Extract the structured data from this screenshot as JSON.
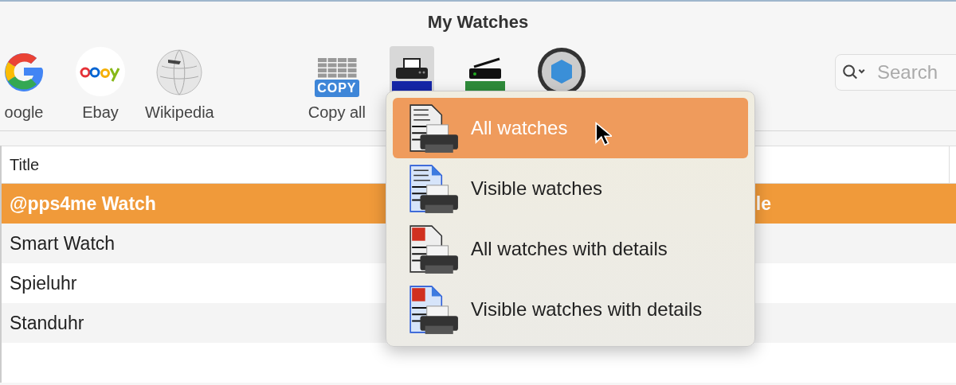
{
  "window": {
    "title": "My Watches"
  },
  "toolbar": {
    "items": [
      {
        "kind": "google",
        "label": "oogle"
      },
      {
        "kind": "ebay",
        "label": "Ebay"
      },
      {
        "kind": "wikipedia",
        "label": "Wikipedia"
      },
      {
        "kind": "copy",
        "label": "Copy all",
        "badge": "COPY"
      },
      {
        "kind": "print"
      },
      {
        "kind": "scan"
      },
      {
        "kind": "aperture"
      }
    ],
    "search": {
      "placeholder": "Search"
    }
  },
  "table": {
    "columns": [
      "Title"
    ],
    "rows": [
      {
        "title": "@pps4me Watch",
        "column_2": "le",
        "selected": true
      },
      {
        "title": "Smart Watch",
        "selected": false
      },
      {
        "title": "Spieluhr",
        "selected": false
      },
      {
        "title": "Standuhr",
        "selected": false
      }
    ]
  },
  "menu": {
    "items": [
      {
        "label": "All watches",
        "kind": "all",
        "selected": true
      },
      {
        "label": "Visible watches",
        "kind": "visible",
        "selected": false
      },
      {
        "label": "All watches with details",
        "kind": "all-details",
        "selected": false
      },
      {
        "label": "Visible watches with details",
        "kind": "visible-details",
        "selected": false
      }
    ]
  }
}
